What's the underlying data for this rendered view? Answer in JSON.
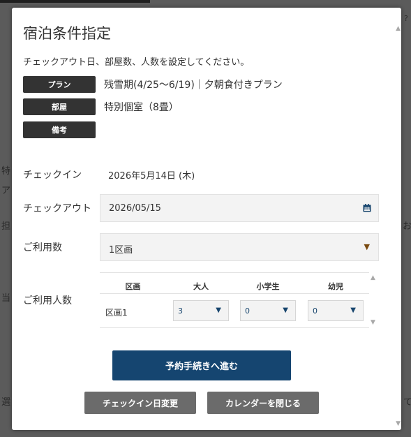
{
  "background": {
    "fragments": [
      "特",
      "ア",
      "担",
      "当",
      "選",
      "お",
      "て",
      "?"
    ]
  },
  "modal": {
    "title": "宿泊条件指定",
    "intro": "チェックアウト日、部屋数、人数を設定してください。",
    "tags": [
      {
        "label": "プラン",
        "value": "残雪期(4/25～6/19)｜夕朝食付きプラン"
      },
      {
        "label": "部屋",
        "value": "特別個室（8畳）"
      },
      {
        "label": "備考",
        "value": ""
      }
    ],
    "checkin": {
      "label": "チェックイン",
      "value": "2026年5月14日 (木)"
    },
    "checkout": {
      "label": "チェックアウト",
      "value": "2026/05/15",
      "icon": "calendar-icon"
    },
    "usage_count": {
      "label": "ご利用数",
      "value": "1区画"
    },
    "guests": {
      "label": "ご利用人数",
      "columns": [
        "区画",
        "大人",
        "小学生",
        "幼児"
      ],
      "row": {
        "name": "区画1",
        "adults": "3",
        "elementary": "0",
        "infants": "0"
      }
    },
    "buttons": {
      "proceed": "予約手続きへ進む",
      "change_checkin": "チェックイン日変更",
      "close_calendar": "カレンダーを閉じる"
    }
  },
  "colors": {
    "primary": "#154570",
    "tag_bg": "#333333",
    "secondary_button": "#6b6b6b"
  }
}
